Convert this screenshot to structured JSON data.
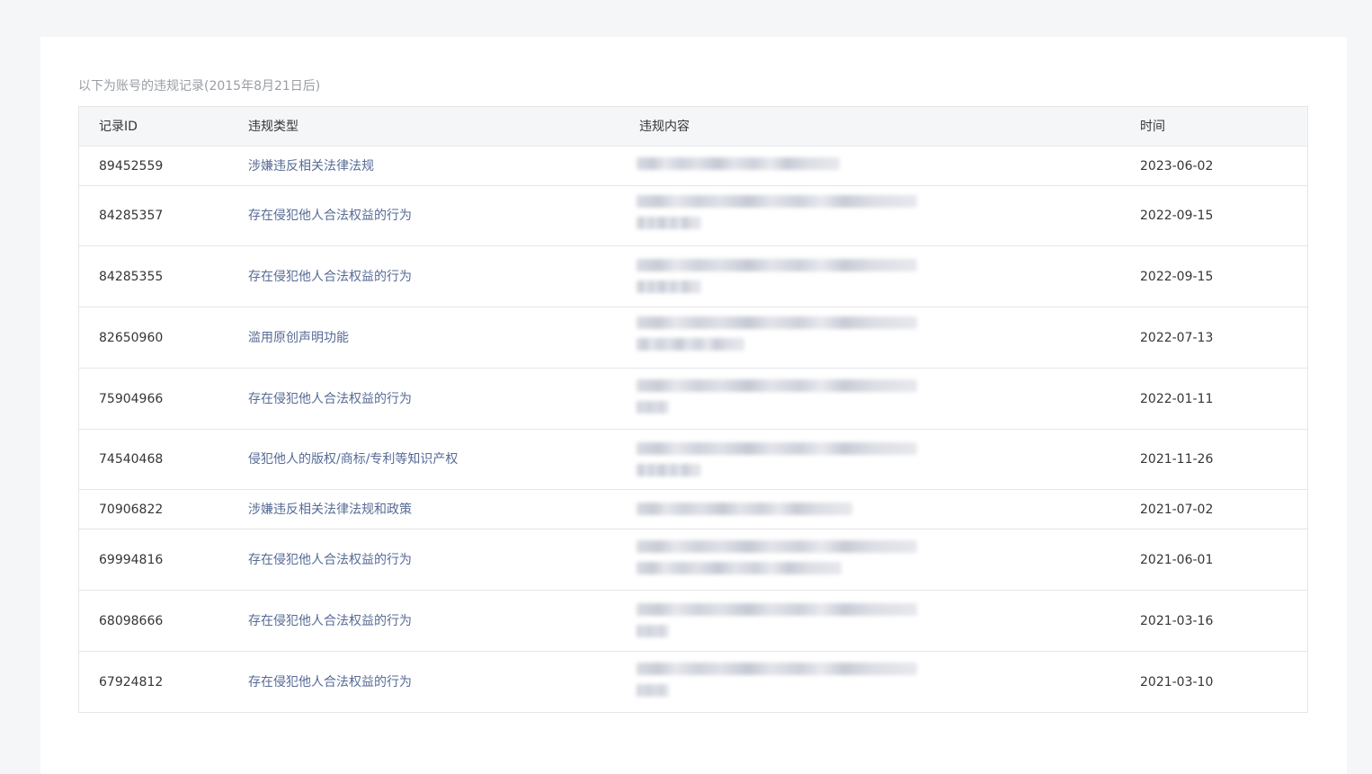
{
  "caption": "以下为账号的违规记录(2015年8月21日后)",
  "table": {
    "headers": {
      "id": "记录ID",
      "type": "违规类型",
      "content": "违规内容",
      "time": "时间"
    },
    "rows": [
      {
        "id": "89452559",
        "type": "涉嫌违反相关法律法规",
        "time": "2023-06-02",
        "content_redacted": true
      },
      {
        "id": "84285357",
        "type": "存在侵犯他人合法权益的行为",
        "time": "2022-09-15",
        "content_redacted": true
      },
      {
        "id": "84285355",
        "type": "存在侵犯他人合法权益的行为",
        "time": "2022-09-15",
        "content_redacted": true
      },
      {
        "id": "82650960",
        "type": "滥用原创声明功能",
        "time": "2022-07-13",
        "content_redacted": true
      },
      {
        "id": "75904966",
        "type": "存在侵犯他人合法权益的行为",
        "time": "2022-01-11",
        "content_redacted": true
      },
      {
        "id": "74540468",
        "type": "侵犯他人的版权/商标/专利等知识产权",
        "time": "2021-11-26",
        "content_redacted": true
      },
      {
        "id": "70906822",
        "type": "涉嫌违反相关法律法规和政策",
        "time": "2021-07-02",
        "content_redacted": true
      },
      {
        "id": "69994816",
        "type": "存在侵犯他人合法权益的行为",
        "time": "2021-06-01",
        "content_redacted": true
      },
      {
        "id": "68098666",
        "type": "存在侵犯他人合法权益的行为",
        "time": "2021-03-16",
        "content_redacted": true
      },
      {
        "id": "67924812",
        "type": "存在侵犯他人合法权益的行为",
        "time": "2021-03-10",
        "content_redacted": true
      }
    ]
  },
  "colors": {
    "page_bg": "#f5f6f8",
    "card_bg": "#ffffff",
    "link": "#576b95",
    "text": "#353535",
    "caption": "#9a9da3",
    "border": "#e5e6e8"
  }
}
